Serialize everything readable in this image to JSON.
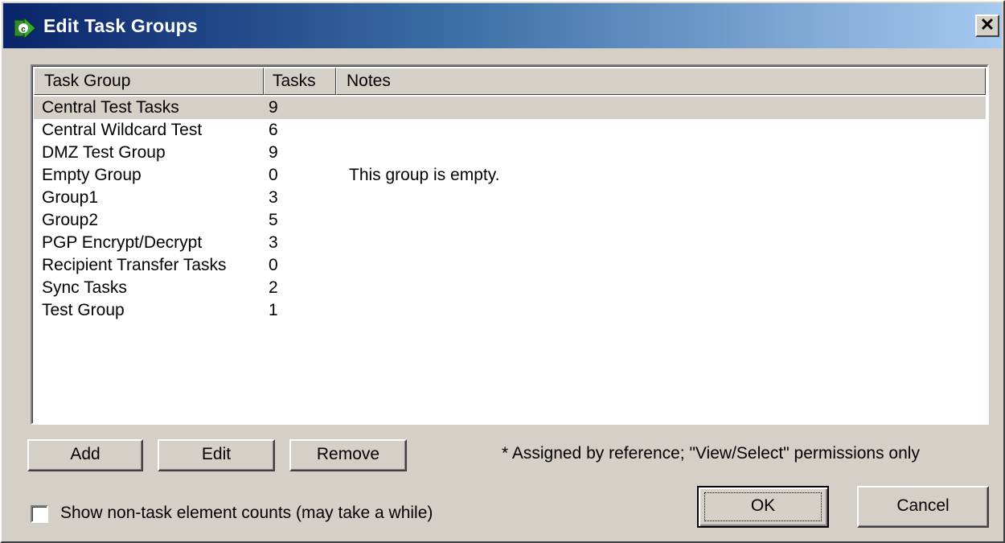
{
  "window": {
    "title": "Edit Task Groups",
    "close_label": "✕"
  },
  "columns": [
    "Task Group",
    "Tasks",
    "Notes"
  ],
  "rows": [
    {
      "group": "Central Test Tasks",
      "tasks": "9",
      "notes": ""
    },
    {
      "group": "Central Wildcard Test",
      "tasks": "6",
      "notes": ""
    },
    {
      "group": "DMZ Test Group",
      "tasks": "9",
      "notes": ""
    },
    {
      "group": "Empty Group",
      "tasks": "0",
      "notes": "This group is empty."
    },
    {
      "group": "Group1",
      "tasks": "3",
      "notes": ""
    },
    {
      "group": "Group2",
      "tasks": "5",
      "notes": ""
    },
    {
      "group": "PGP Encrypt/Decrypt",
      "tasks": "3",
      "notes": ""
    },
    {
      "group": "Recipient Transfer Tasks",
      "tasks": "0",
      "notes": ""
    },
    {
      "group": "Sync Tasks",
      "tasks": "2",
      "notes": ""
    },
    {
      "group": "Test Group",
      "tasks": "1",
      "notes": ""
    }
  ],
  "selected_row": 0,
  "buttons": {
    "add": "Add",
    "edit": "Edit",
    "remove": "Remove",
    "ok": "OK",
    "cancel": "Cancel"
  },
  "note": "* Assigned by reference; \"View/Select\" permissions only",
  "checkbox": {
    "label": "Show non-task element counts (may take a while)",
    "checked": false
  },
  "colors": {
    "title_gradient_start": "#0a246a",
    "title_gradient_end": "#a6caf0",
    "dialog_background": "#d4d0c8",
    "app_icon": "#2e8b2e"
  },
  "icons": {
    "app": "green-arrow-c-icon",
    "close": "close-x-icon"
  }
}
